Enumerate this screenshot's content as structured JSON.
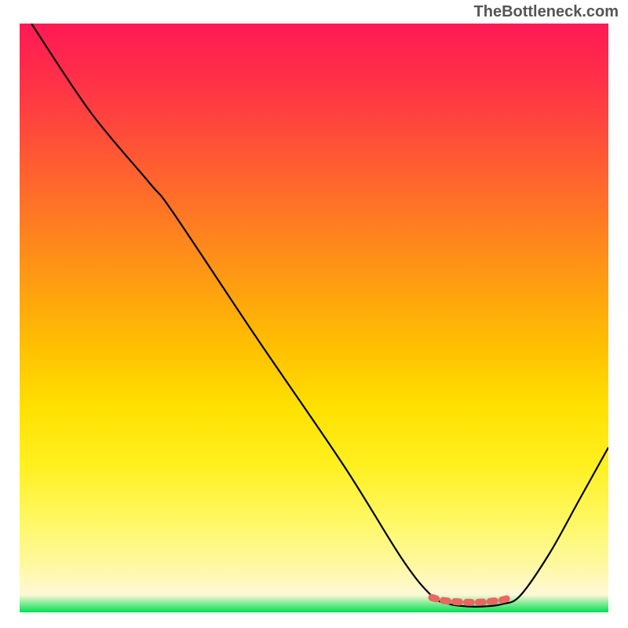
{
  "watermark": "TheBottleneck.com",
  "chart_data": {
    "type": "line",
    "title": "",
    "xlabel": "",
    "ylabel": "",
    "xlim": [
      0,
      100
    ],
    "ylim": [
      0,
      100
    ],
    "gradient_stops": [
      {
        "offset": 0.0,
        "color": "#ff1a55"
      },
      {
        "offset": 0.07,
        "color": "#ff2a4b"
      },
      {
        "offset": 0.15,
        "color": "#ff4040"
      },
      {
        "offset": 0.25,
        "color": "#ff6030"
      },
      {
        "offset": 0.35,
        "color": "#ff8020"
      },
      {
        "offset": 0.45,
        "color": "#ffa010"
      },
      {
        "offset": 0.55,
        "color": "#ffc000"
      },
      {
        "offset": 0.65,
        "color": "#ffe000"
      },
      {
        "offset": 0.75,
        "color": "#fff020"
      },
      {
        "offset": 0.85,
        "color": "#fff868"
      },
      {
        "offset": 0.92,
        "color": "#fff8a0"
      },
      {
        "offset": 0.97,
        "color": "#fff8d8"
      },
      {
        "offset": 1.0,
        "color": "#00e050"
      }
    ],
    "series": [
      {
        "name": "bottleneck-curve",
        "color": "#000000",
        "points": [
          {
            "x": 2.0,
            "y": 100.0
          },
          {
            "x": 12.0,
            "y": 85.0
          },
          {
            "x": 22.0,
            "y": 73.0
          },
          {
            "x": 26.0,
            "y": 68.0
          },
          {
            "x": 40.0,
            "y": 47.0
          },
          {
            "x": 55.0,
            "y": 25.0
          },
          {
            "x": 65.0,
            "y": 9.0
          },
          {
            "x": 70.0,
            "y": 2.8
          },
          {
            "x": 73.0,
            "y": 1.4
          },
          {
            "x": 76.0,
            "y": 1.0
          },
          {
            "x": 79.0,
            "y": 1.0
          },
          {
            "x": 82.0,
            "y": 1.4
          },
          {
            "x": 85.0,
            "y": 2.8
          },
          {
            "x": 90.0,
            "y": 10.0
          },
          {
            "x": 95.0,
            "y": 19.0
          },
          {
            "x": 100.0,
            "y": 28.0
          }
        ]
      },
      {
        "name": "optimal-indicator",
        "color": "#e86860",
        "marker": "round-thick",
        "points": [
          {
            "x": 70.0,
            "y": 2.5
          },
          {
            "x": 72.0,
            "y": 2.0
          },
          {
            "x": 74.0,
            "y": 1.8
          },
          {
            "x": 76.0,
            "y": 1.7
          },
          {
            "x": 78.0,
            "y": 1.7
          },
          {
            "x": 79.5,
            "y": 1.8
          },
          {
            "x": 82.0,
            "y": 2.1
          },
          {
            "x": 83.5,
            "y": 2.6
          }
        ]
      }
    ]
  }
}
